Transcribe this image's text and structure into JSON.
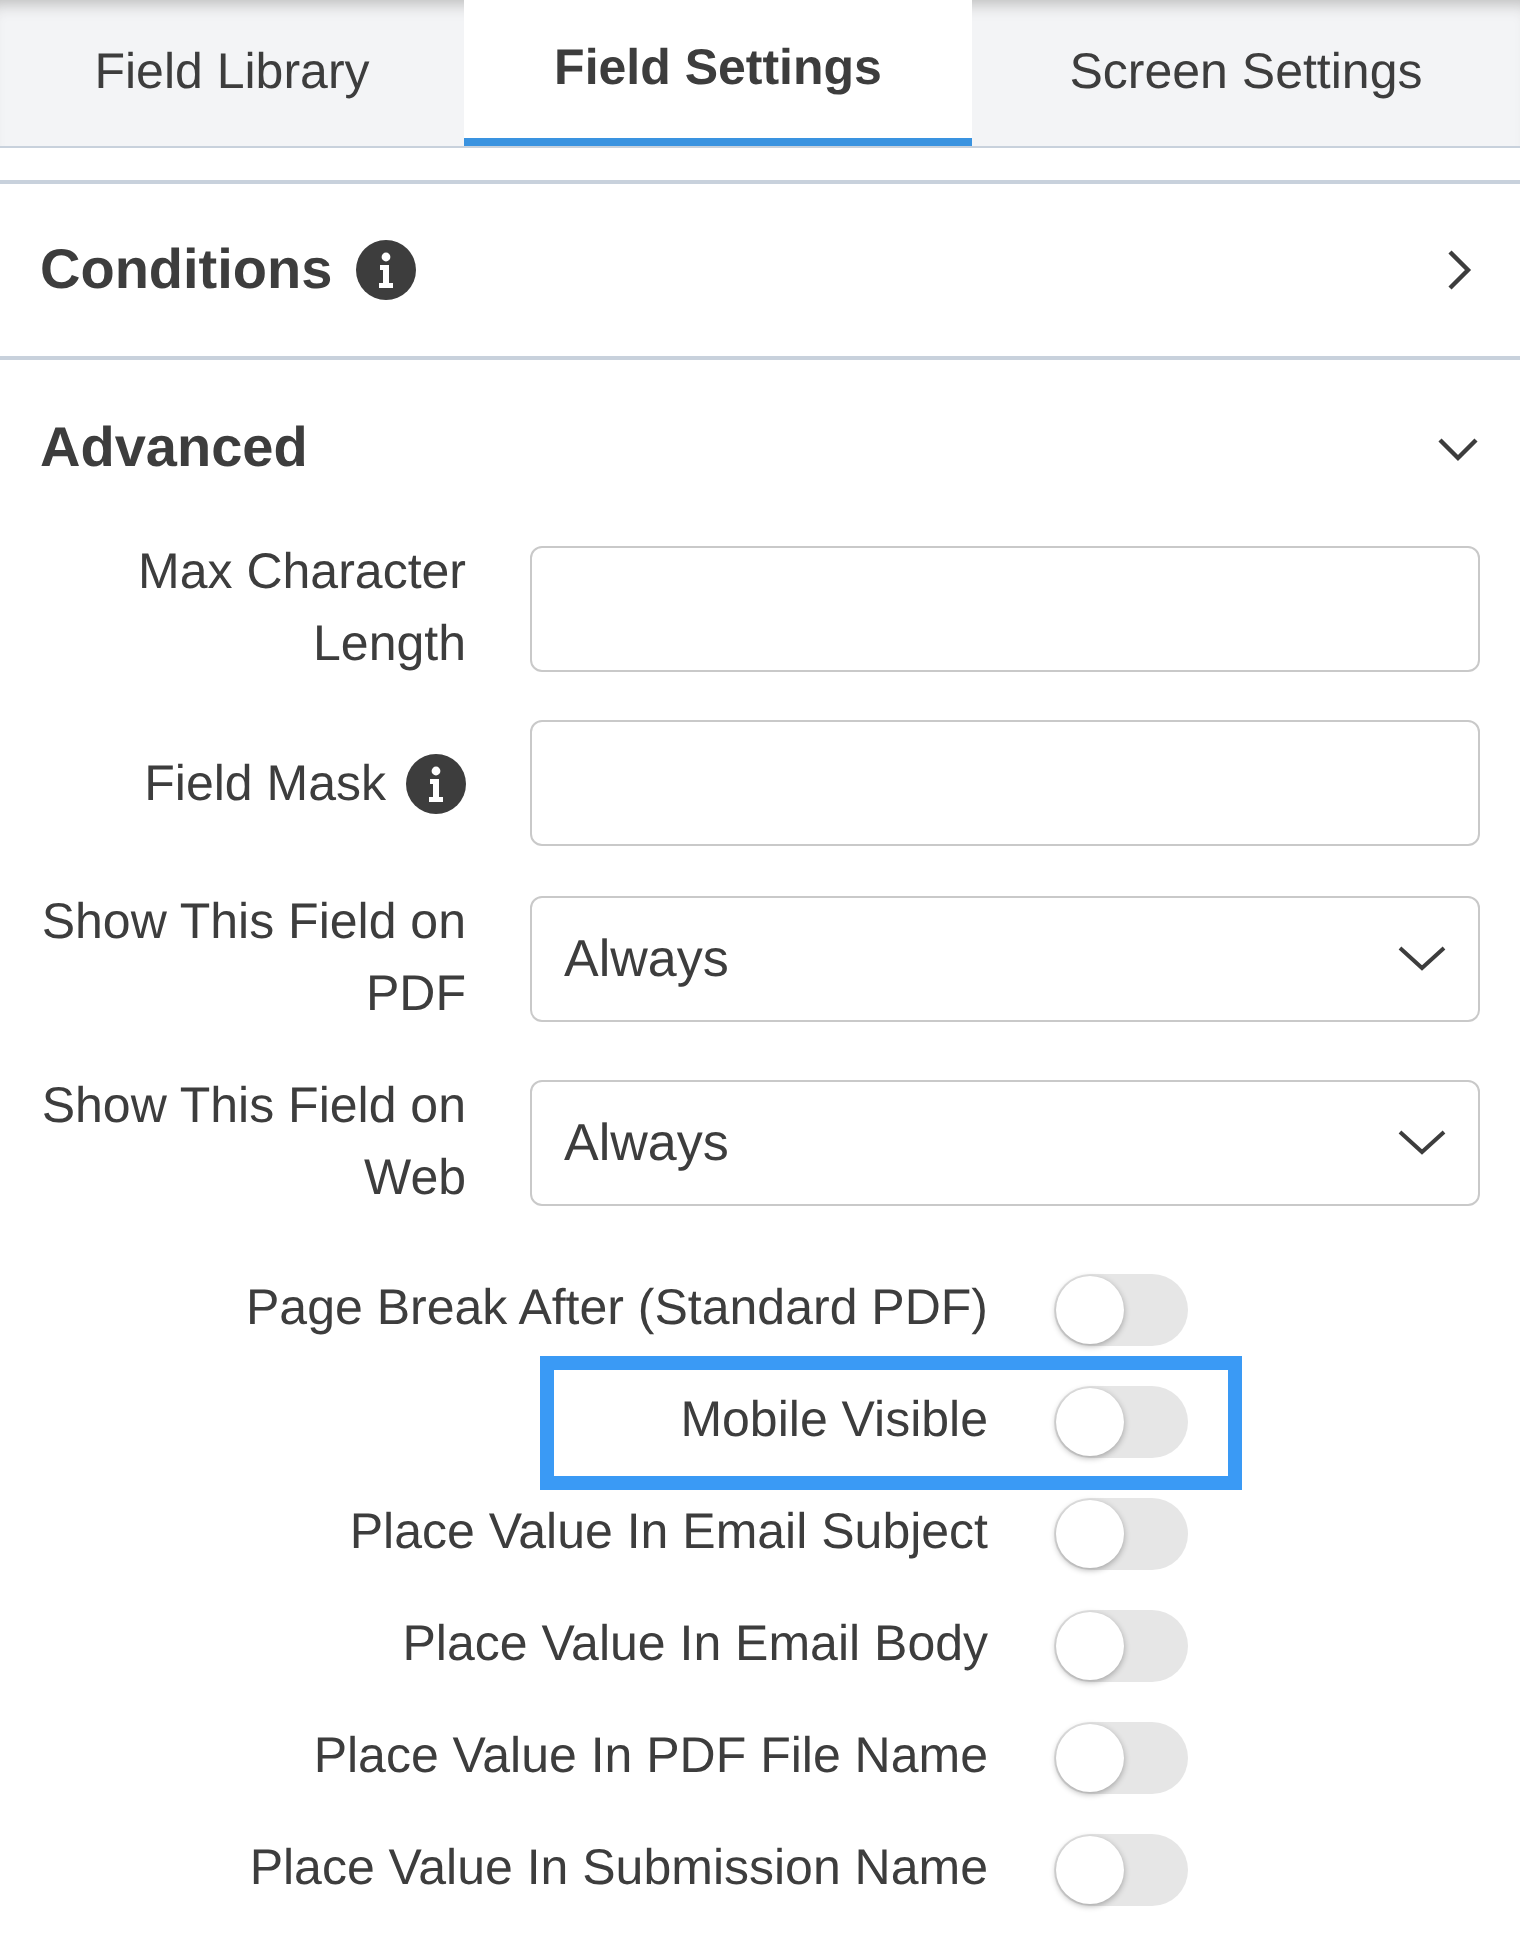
{
  "tabs": [
    {
      "label": "Field Library",
      "selected": false
    },
    {
      "label": "Field Settings",
      "selected": true
    },
    {
      "label": "Screen Settings",
      "selected": false
    }
  ],
  "sections": [
    {
      "title": "Conditions",
      "info": true,
      "expanded": false
    },
    {
      "title": "Advanced",
      "info": false,
      "expanded": true
    }
  ],
  "fields": [
    {
      "kind": "text",
      "label": "Max Character Length",
      "info": false
    },
    {
      "kind": "text",
      "label": "Field Mask",
      "info": true
    },
    {
      "kind": "select",
      "label": "Show This Field on PDF",
      "info": false,
      "value": "Always"
    },
    {
      "kind": "select",
      "label": "Show This Field on Web",
      "info": false,
      "value": "Always"
    }
  ],
  "toggles": [
    {
      "label": "Page Break After (Standard PDF)",
      "on": false,
      "highlighted": false
    },
    {
      "label": "Mobile Visible",
      "on": false,
      "highlighted": true
    },
    {
      "label": "Place Value In Email Subject",
      "on": false,
      "highlighted": false
    },
    {
      "label": "Place Value In Email Body",
      "on": false,
      "highlighted": false
    },
    {
      "label": "Place Value In PDF File Name",
      "on": false,
      "highlighted": false
    },
    {
      "label": "Place Value In Submission Name",
      "on": false,
      "highlighted": false
    }
  ]
}
